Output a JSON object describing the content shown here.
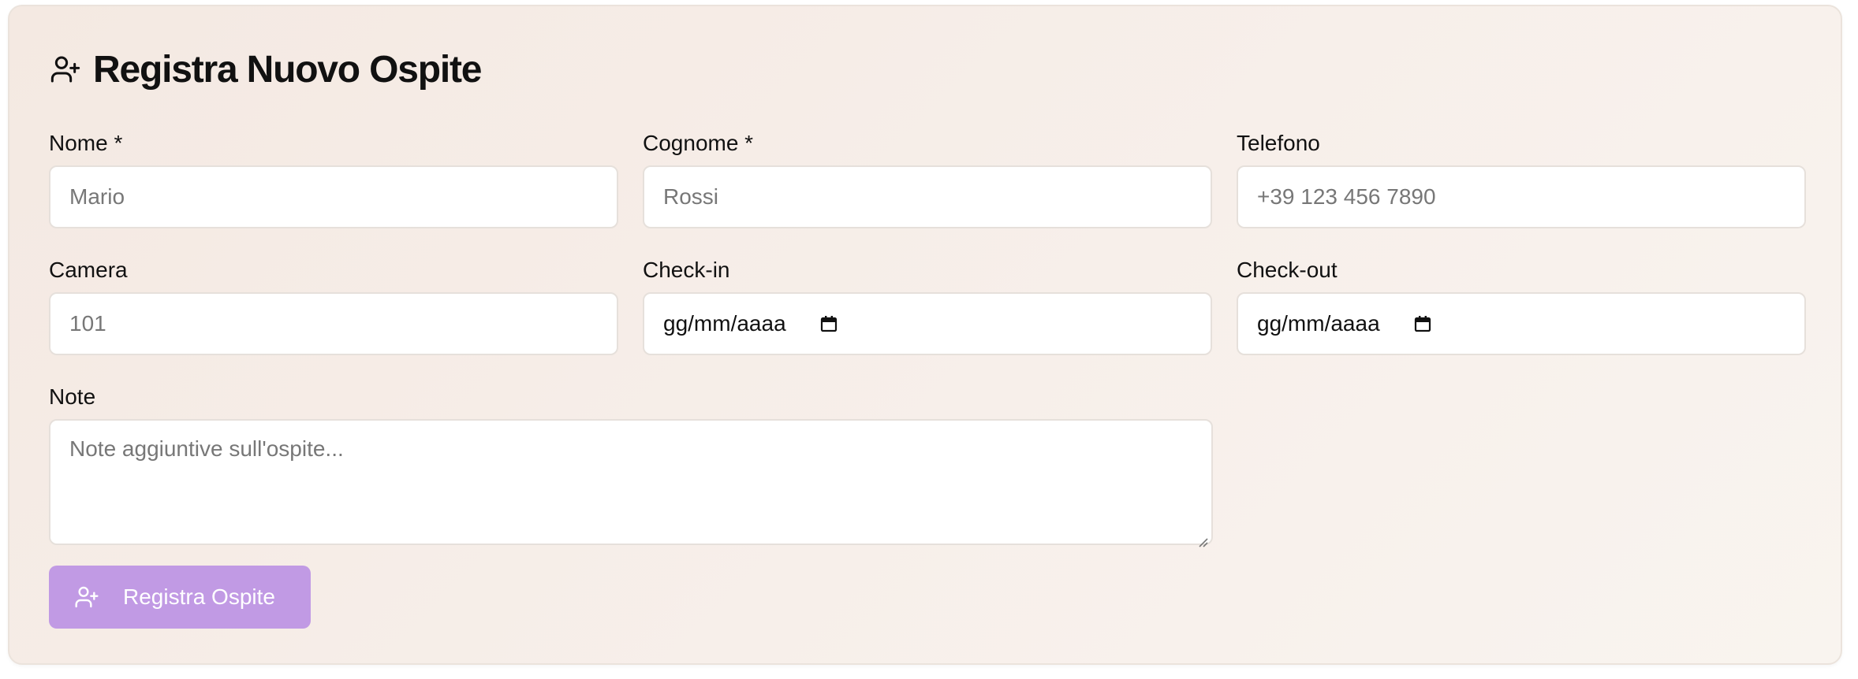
{
  "form": {
    "title": "Registra Nuovo Ospite",
    "title_icon": "user-plus-icon",
    "fields": {
      "nome": {
        "label": "Nome *",
        "placeholder": "Mario"
      },
      "cognome": {
        "label": "Cognome *",
        "placeholder": "Rossi"
      },
      "telefono": {
        "label": "Telefono",
        "placeholder": "+39 123 456 7890"
      },
      "camera": {
        "label": "Camera",
        "placeholder": "101"
      },
      "checkin": {
        "label": "Check-in",
        "value": "gg/mm/aaaa",
        "icon": "calendar-icon"
      },
      "checkout": {
        "label": "Check-out",
        "value": "gg/mm/aaaa",
        "icon": "calendar-icon"
      },
      "note": {
        "label": "Note",
        "placeholder": "Note aggiuntive sull'ospite..."
      }
    },
    "submit": {
      "label": "Registra Ospite",
      "icon": "user-plus-icon",
      "color": "#c19ae4"
    }
  },
  "colors": {
    "card_background": "#f6ece6",
    "text": "#111111",
    "placeholder": "#777777",
    "button": "#c19ae4"
  }
}
